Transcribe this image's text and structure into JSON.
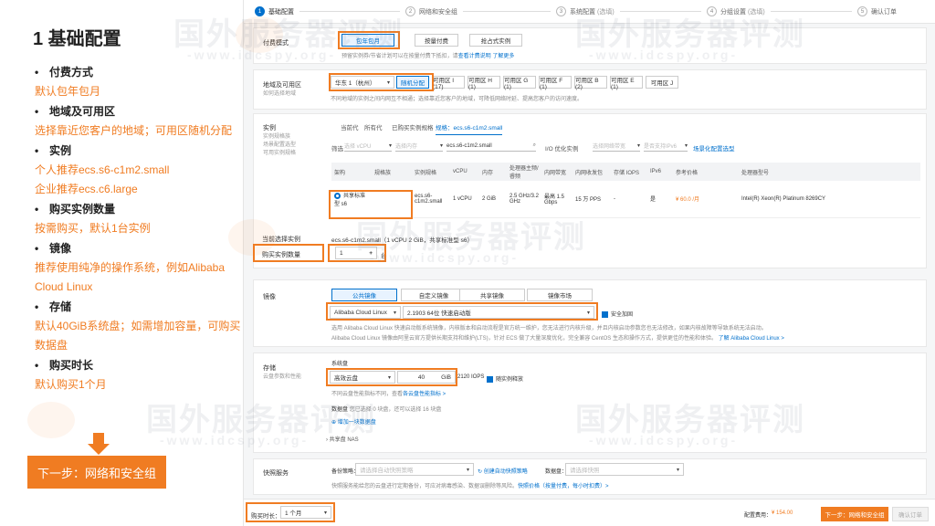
{
  "left_panel": {
    "title": "1 基础配置",
    "items": [
      {
        "heading": "付费方式",
        "desc": [
          "默认包年包月"
        ]
      },
      {
        "heading": "地域及可用区",
        "desc": [
          "选择靠近您客户的地域；可用区随机分配"
        ]
      },
      {
        "heading": "实例",
        "desc": [
          "个人推荐ecs.s6-c1m2.small",
          "企业推荐ecs.c6.large"
        ]
      },
      {
        "heading": "购买实例数量",
        "desc": [
          "按需购买，默认1台实例"
        ]
      },
      {
        "heading": "镜像",
        "desc": [
          "推荐使用纯净的操作系统，例如Alibaba Cloud Linux"
        ]
      },
      {
        "heading": "存储",
        "desc": [
          "默认40GiB系统盘；如需增加容量，可购买数据盘"
        ]
      },
      {
        "heading": "购买时长",
        "desc": [
          "默认购买1个月"
        ]
      }
    ],
    "bullet": "•",
    "next_label": "下一步：网络和安全组"
  },
  "watermark": {
    "text": "国外服务器评测",
    "url": "-www.idcspy.org-"
  },
  "steps": [
    {
      "num": "1",
      "label": "基础配置",
      "sub": "",
      "active": true
    },
    {
      "num": "2",
      "label": "网络和安全组",
      "sub": "",
      "active": false
    },
    {
      "num": "3",
      "label": "系统配置",
      "sub": "(选填)",
      "active": false
    },
    {
      "num": "4",
      "label": "分组设置",
      "sub": "(选填)",
      "active": false
    },
    {
      "num": "5",
      "label": "确认订单",
      "sub": "",
      "active": false
    }
  ],
  "billing": {
    "label": "付费模式",
    "options": [
      "包年包月",
      "按量付费",
      "抢占式实例"
    ],
    "selected": "包年包月",
    "note": "预留实例券/节省计划可以在按量付费下抵扣，请",
    "link": "查看计费说明 了解更多"
  },
  "region": {
    "label": "地域及可用区",
    "sublabel": "如何选择地域",
    "region_value": "华东 1（杭州）",
    "zones": [
      "随机分配",
      "可用区 I (17)",
      "可用区 H (1)",
      "可用区 G (1)",
      "可用区 F (1)",
      "可用区 B (2)",
      "可用区 E (1)",
      "可用区 J"
    ],
    "note": "不同地域的实例之间内网互不相通；选择靠近您客户的地域，可降低网络时延、提高您客户的访问速度。"
  },
  "instance": {
    "label": "实例",
    "sublabels": [
      "实例规格族",
      "场景配置选型",
      "可用实例规格"
    ],
    "tabs": [
      "当前代",
      "所有代",
      "已购买实例规格",
      "规格：ecs.s6-c1m2.small"
    ],
    "filter_label": "筛选",
    "filter_vcpu": "选择 vCPU",
    "filter_mem": "选择内存",
    "search_value": "ecs.s6-c1m2.small",
    "io_label": "I/O 优化实例",
    "filter_net": "选择网络带宽",
    "filter_ipv6": "是否支持IPv6",
    "scene_link": "场景化配置选型",
    "columns": [
      "架构",
      "规格族",
      "实例规格",
      "vCPU",
      "内存",
      "处理器主频/睿频",
      "内网带宽",
      "内网收发包",
      "存储 IOPS",
      "IPv6",
      "参考价格",
      "处理器型号"
    ],
    "row": {
      "arch": "共享标准型 s6",
      "family": "",
      "spec": "ecs.s6-c1m2.small",
      "vcpu": "1 vCPU",
      "mem": "2 GiB",
      "freq": "2.5 GHz/3.2 GHz",
      "bandwidth": "最高 1.5 Gbps",
      "pps": "15 万 PPS",
      "iops": "-",
      "ipv6": "是",
      "price": "¥ 60.0 /月",
      "cpu_model": "Intel(R) Xeon(R) Platinum 8269CY"
    },
    "selected_label": "当前选择实例",
    "selected_value": "ecs.s6-c1m2.small（1 vCPU 2 GiB，共享标准型 s6）",
    "count_label": "购买实例数量",
    "count_value": "1",
    "count_unit": "台"
  },
  "image": {
    "label": "镜像",
    "tabs": [
      "公共镜像",
      "自定义镜像",
      "共享镜像",
      "镜像市场"
    ],
    "os": "Alibaba Cloud Linux",
    "version": "2.1903 64位 快速启动版",
    "security": "安全加固",
    "note1": "选用 Alibaba Cloud Linux 快速启动版系统镜像，内核版本和启动流程是官方统一维护，您无法进行内核升级，并且内核启动参数您也无法修改，如果内核故障等导致系统无法启动。",
    "note2": "Alibaba Cloud Linux 镜像由阿里云官方提供长期支持和维护(LTS)，针对 ECS 做了大量深度优化，完全兼容 CentOS 生态和操作方式，提供更佳的性能和体验。",
    "note2_link": "了解 Alibaba Cloud Linux >"
  },
  "storage": {
    "label": "存储",
    "sublabel": "云盘参数和性能",
    "sys_label": "系统盘",
    "disk_type": "高效云盘",
    "size": "40",
    "unit": "GiB",
    "iops": "2120 IOPS",
    "release": "随实例释放",
    "note": "不同云盘性能指标不同，查看",
    "note_link": "各云盘性能指标 >",
    "data_label": "数据盘",
    "data_note": "您已选择 0 块盘，还可以选择 16 块盘",
    "add_disk": "增加一块数据盘",
    "nas": "共享盘 NAS"
  },
  "snapshot": {
    "label": "快照服务",
    "policy_label": "备份策略：",
    "policy_placeholder": "请选择自动快照策略",
    "create_link": "创建自动快照策略",
    "data_label": "数据盘：",
    "data_placeholder": "请选择快照",
    "note": "快照服务能给您的云盘进行定期备份，可应对病毒感染、数据误删除等风险。",
    "note_link": "快照价格（按量付费，每小时扣费）>"
  },
  "bottom": {
    "duration_label": "购买时长：",
    "duration_value": "1 个月",
    "cost_label": "配置费用：",
    "cost_value": "¥ 154.00",
    "next_button": "下一步：网络和安全组",
    "confirm_button": "确认订单"
  }
}
